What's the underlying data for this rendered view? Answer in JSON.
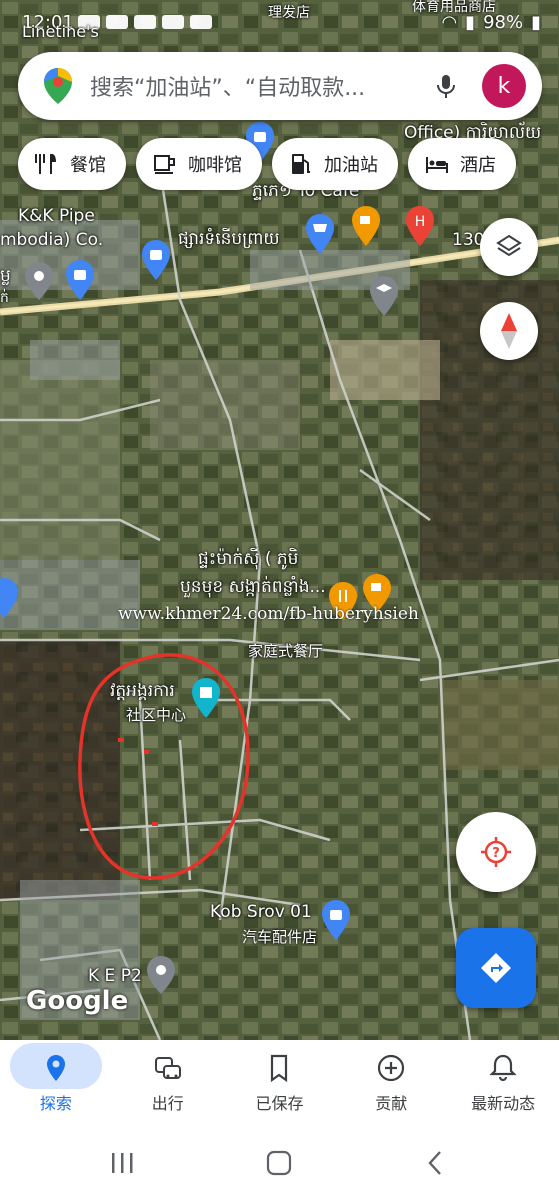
{
  "status_bar": {
    "time": "12:01",
    "battery": "98%",
    "top_label_1": "理发店",
    "top_label_2": "体育用品商店",
    "top_label_3": "Linetine's"
  },
  "search": {
    "placeholder": "搜索“加油站”、“自动取款...",
    "avatar_letter": "k"
  },
  "chips": [
    {
      "label": "餐馆",
      "icon": "restaurant-icon"
    },
    {
      "label": "咖啡馆",
      "icon": "cafe-icon"
    },
    {
      "label": "加油站",
      "icon": "gas-station-icon"
    },
    {
      "label": "酒店",
      "icon": "hotel-icon"
    }
  ],
  "map_labels": {
    "kk_pipe_1": "K&K Pipe",
    "kk_pipe_2": "mbodia) Co.",
    "khmer_store": "ផ្សារទំនើបព្រាយ",
    "cafe_label": "ភ្ទភេ១ To Cafe",
    "office": "Office) ការិយាល័យ",
    "road_num": "130",
    "khmer_left": "ម្ល",
    "khmer_left2": "ក់",
    "house_khmer_1": "ផ្ទះម៉ាក់ស៊ី ( ភូមិ",
    "house_khmer_2": "បួនមុខ សង្កាត់ពន្លាំង...",
    "family_restaurant": "家庭式餐厅",
    "community_khmer": "វត្តអង្គរការ",
    "community_center": "社区中心",
    "kob_srov": "Kob Srov 01",
    "auto_parts": "汽车配件店",
    "kep2": "K E P2",
    "google": "Google"
  },
  "watermark": "www.khmer24.com/fb-huberyhsieh",
  "bottom_nav": [
    {
      "label": "探索",
      "icon": "location-pin-icon",
      "active": true
    },
    {
      "label": "出行",
      "icon": "commute-icon",
      "active": false
    },
    {
      "label": "已保存",
      "icon": "bookmark-icon",
      "active": false
    },
    {
      "label": "贡献",
      "icon": "add-circle-icon",
      "active": false
    },
    {
      "label": "最新动态",
      "icon": "bell-icon",
      "active": false
    }
  ],
  "colors": {
    "accent": "#1a73e8",
    "avatar": "#c2185b",
    "poi_blue": "#4285f4",
    "poi_orange": "#f29900",
    "poi_red": "#ea4335",
    "highlight_circle": "#e5332a"
  }
}
